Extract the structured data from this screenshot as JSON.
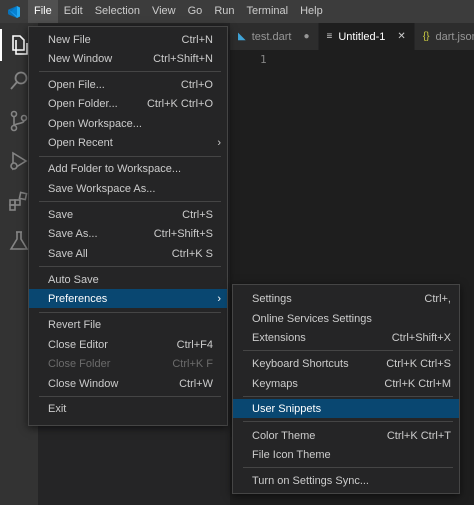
{
  "menubar": [
    "File",
    "Edit",
    "Selection",
    "View",
    "Go",
    "Run",
    "Terminal",
    "Help"
  ],
  "tabs": [
    {
      "label": "test.dart",
      "state": "●",
      "icon": "dart-icon"
    },
    {
      "label": "Untitled-1",
      "state": "✕",
      "icon": "text-file-icon"
    },
    {
      "label": "dart.json",
      "state": "",
      "icon": "json-icon"
    }
  ],
  "editor": {
    "line_number": "1"
  },
  "file_menu": [
    {
      "label": "New File",
      "kb": "Ctrl+N"
    },
    {
      "label": "New Window",
      "kb": "Ctrl+Shift+N"
    },
    {
      "label": "Open File...",
      "kb": "Ctrl+O"
    },
    {
      "label": "Open Folder...",
      "kb": "Ctrl+K Ctrl+O"
    },
    {
      "label": "Open Workspace...",
      "kb": ""
    },
    {
      "label": "Open Recent",
      "kb": "",
      "submenu": true
    },
    {
      "label": "Add Folder to Workspace...",
      "kb": ""
    },
    {
      "label": "Save Workspace As...",
      "kb": ""
    },
    {
      "label": "Save",
      "kb": "Ctrl+S"
    },
    {
      "label": "Save As...",
      "kb": "Ctrl+Shift+S"
    },
    {
      "label": "Save All",
      "kb": "Ctrl+K S"
    },
    {
      "label": "Auto Save",
      "kb": ""
    },
    {
      "label": "Preferences",
      "kb": "",
      "submenu": true,
      "highlight": true
    },
    {
      "label": "Revert File",
      "kb": ""
    },
    {
      "label": "Close Editor",
      "kb": "Ctrl+F4"
    },
    {
      "label": "Close Folder",
      "kb": "Ctrl+K F",
      "disabled": true
    },
    {
      "label": "Close Window",
      "kb": "Ctrl+W"
    },
    {
      "label": "Exit",
      "kb": ""
    }
  ],
  "prefs_menu": [
    {
      "label": "Settings",
      "kb": "Ctrl+,"
    },
    {
      "label": "Online Services Settings",
      "kb": ""
    },
    {
      "label": "Extensions",
      "kb": "Ctrl+Shift+X"
    },
    {
      "label": "Keyboard Shortcuts",
      "kb": "Ctrl+K Ctrl+S"
    },
    {
      "label": "Keymaps",
      "kb": "Ctrl+K Ctrl+M"
    },
    {
      "label": "User Snippets",
      "kb": "",
      "highlight": true
    },
    {
      "label": "Color Theme",
      "kb": "Ctrl+K Ctrl+T"
    },
    {
      "label": "File Icon Theme",
      "kb": ""
    },
    {
      "label": "Turn on Settings Sync...",
      "kb": ""
    }
  ]
}
